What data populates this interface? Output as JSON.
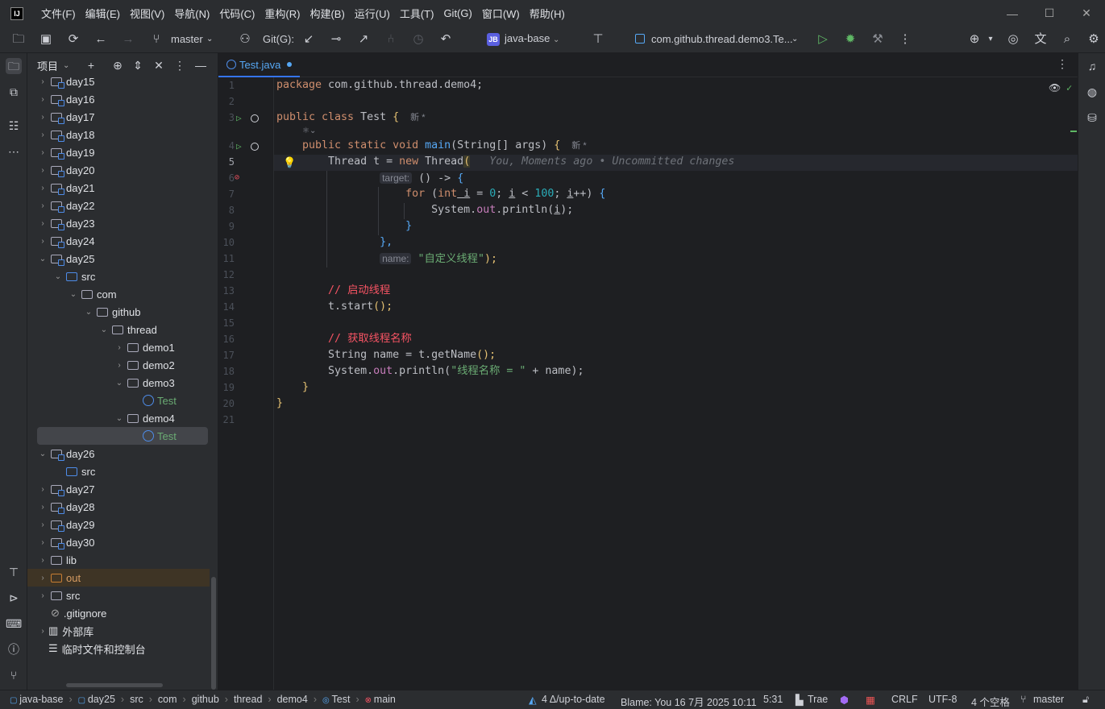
{
  "menubar": {
    "items": [
      "文件(F)",
      "编辑(E)",
      "视图(V)",
      "导航(N)",
      "代码(C)",
      "重构(R)",
      "构建(B)",
      "运行(U)",
      "工具(T)",
      "Git(G)",
      "窗口(W)",
      "帮助(H)"
    ]
  },
  "toolbar": {
    "branch": "master",
    "git_label": "Git(G):",
    "project": "java-base",
    "project_badge": "JB",
    "run_config": "com.github.thread.demo3.Te..."
  },
  "panel": {
    "title": "项目"
  },
  "tree": [
    {
      "label": "day15",
      "indent": 0,
      "chevron": "›",
      "icon": "module",
      "state": "normal"
    },
    {
      "label": "day16",
      "indent": 0,
      "chevron": "›",
      "icon": "module",
      "state": "normal"
    },
    {
      "label": "day17",
      "indent": 0,
      "chevron": "›",
      "icon": "module",
      "state": "normal"
    },
    {
      "label": "day18",
      "indent": 0,
      "chevron": "›",
      "icon": "module",
      "state": "normal"
    },
    {
      "label": "day19",
      "indent": 0,
      "chevron": "›",
      "icon": "module",
      "state": "normal"
    },
    {
      "label": "day20",
      "indent": 0,
      "chevron": "›",
      "icon": "module",
      "state": "normal"
    },
    {
      "label": "day21",
      "indent": 0,
      "chevron": "›",
      "icon": "module",
      "state": "normal"
    },
    {
      "label": "day22",
      "indent": 0,
      "chevron": "›",
      "icon": "module",
      "state": "normal"
    },
    {
      "label": "day23",
      "indent": 0,
      "chevron": "›",
      "icon": "module",
      "state": "normal"
    },
    {
      "label": "day24",
      "indent": 0,
      "chevron": "›",
      "icon": "module",
      "state": "normal"
    },
    {
      "label": "day25",
      "indent": 0,
      "chevron": "⌄",
      "icon": "module",
      "state": "normal"
    },
    {
      "label": "src",
      "indent": 1,
      "chevron": "⌄",
      "icon": "src",
      "state": "normal"
    },
    {
      "label": "com",
      "indent": 2,
      "chevron": "⌄",
      "icon": "package",
      "state": "normal"
    },
    {
      "label": "github",
      "indent": 3,
      "chevron": "⌄",
      "icon": "package",
      "state": "normal"
    },
    {
      "label": "thread",
      "indent": 4,
      "chevron": "⌄",
      "icon": "package",
      "state": "normal"
    },
    {
      "label": "demo1",
      "indent": 5,
      "chevron": "›",
      "icon": "package",
      "state": "normal"
    },
    {
      "label": "demo2",
      "indent": 5,
      "chevron": "›",
      "icon": "package",
      "state": "normal"
    },
    {
      "label": "demo3",
      "indent": 5,
      "chevron": "⌄",
      "icon": "package",
      "state": "normal"
    },
    {
      "label": "Test",
      "indent": 6,
      "chevron": "",
      "icon": "class",
      "state": "new"
    },
    {
      "label": "demo4",
      "indent": 5,
      "chevron": "⌄",
      "icon": "package",
      "state": "normal"
    },
    {
      "label": "Test",
      "indent": 6,
      "chevron": "",
      "icon": "class",
      "state": "selected"
    },
    {
      "label": "day26",
      "indent": 0,
      "chevron": "⌄",
      "icon": "module",
      "state": "normal"
    },
    {
      "label": "src",
      "indent": 1,
      "chevron": "",
      "icon": "src",
      "state": "normal"
    },
    {
      "label": "day27",
      "indent": 0,
      "chevron": "›",
      "icon": "module",
      "state": "normal"
    },
    {
      "label": "day28",
      "indent": 0,
      "chevron": "›",
      "icon": "module",
      "state": "normal"
    },
    {
      "label": "day29",
      "indent": 0,
      "chevron": "›",
      "icon": "module",
      "state": "normal"
    },
    {
      "label": "day30",
      "indent": 0,
      "chevron": "›",
      "icon": "module",
      "state": "normal"
    },
    {
      "label": "lib",
      "indent": 0,
      "chevron": "›",
      "icon": "folder",
      "state": "normal"
    },
    {
      "label": "out",
      "indent": 0,
      "chevron": "›",
      "icon": "excluded",
      "state": "excluded"
    },
    {
      "label": "src",
      "indent": 0,
      "chevron": "›",
      "icon": "folder",
      "state": "normal"
    },
    {
      "label": ".gitignore",
      "indent": 0,
      "chevron": "",
      "icon": "gitignore",
      "state": "normal"
    },
    {
      "label": "外部库",
      "indent": -1,
      "chevron": "›",
      "icon": "lib",
      "state": "normal"
    },
    {
      "label": "临时文件和控制台",
      "indent": -1,
      "chevron": "",
      "icon": "scratch",
      "state": "normal"
    }
  ],
  "editor": {
    "tab_label": "Test.java",
    "current_line": 5,
    "blame_inlay": "You, Moments ago • Uncommitted changes",
    "hint_target": "target:",
    "hint_name": "name:",
    "new_tag": "新 *",
    "line_count": 21
  },
  "code": {
    "l1": [
      "package",
      " com.github.thread.demo4;"
    ],
    "l3": [
      "public class",
      " Test ",
      "{"
    ],
    "l4": [
      "public static void",
      " main",
      "(String[] args) ",
      "{"
    ],
    "l5": [
      "Thread t = ",
      "new",
      " Thread",
      "("
    ],
    "l6": [
      "() -> ",
      "{"
    ],
    "l7": [
      "for",
      " (",
      "int",
      " i",
      " = ",
      "0",
      "; ",
      "i",
      " < ",
      "100",
      "; ",
      "i",
      "++) ",
      "{"
    ],
    "l8": [
      "System.",
      "out",
      ".println(",
      "i",
      ");"
    ],
    "l9": [
      "}"
    ],
    "l10": [
      "},"
    ],
    "l11": [
      "\"自定义线程\"",
      ");"
    ],
    "l13": [
      "// 启动线程"
    ],
    "l14": [
      "t.start",
      "();"
    ],
    "l16": [
      "// 获取线程名称"
    ],
    "l17": [
      "String name = t.getName",
      "();"
    ],
    "l18": [
      "System.",
      "out",
      ".println(",
      "\"线程名称 = \"",
      " + name);"
    ],
    "l19": [
      "}"
    ],
    "l20": [
      "}"
    ]
  },
  "statusbar": {
    "breadcrumbs": [
      "java-base",
      "day25",
      "src",
      "com",
      "github",
      "thread",
      "demo4",
      "Test",
      "main"
    ],
    "git_status": "4 Δ/up-to-date",
    "blame": "Blame: You 16 7月 2025 10:11",
    "position": "5:31",
    "plugin": "Trae",
    "line_sep": "CRLF",
    "encoding": "UTF-8",
    "indent": "4 个空格",
    "branch": "master"
  },
  "colors": {
    "keyword": "#cf8e6d",
    "function": "#56a8f5",
    "string": "#6aab73",
    "number": "#2aacb8",
    "comment_red": "#f75464",
    "field": "#c77dbb",
    "background": "#1e1f22",
    "panel": "#2b2d30"
  }
}
